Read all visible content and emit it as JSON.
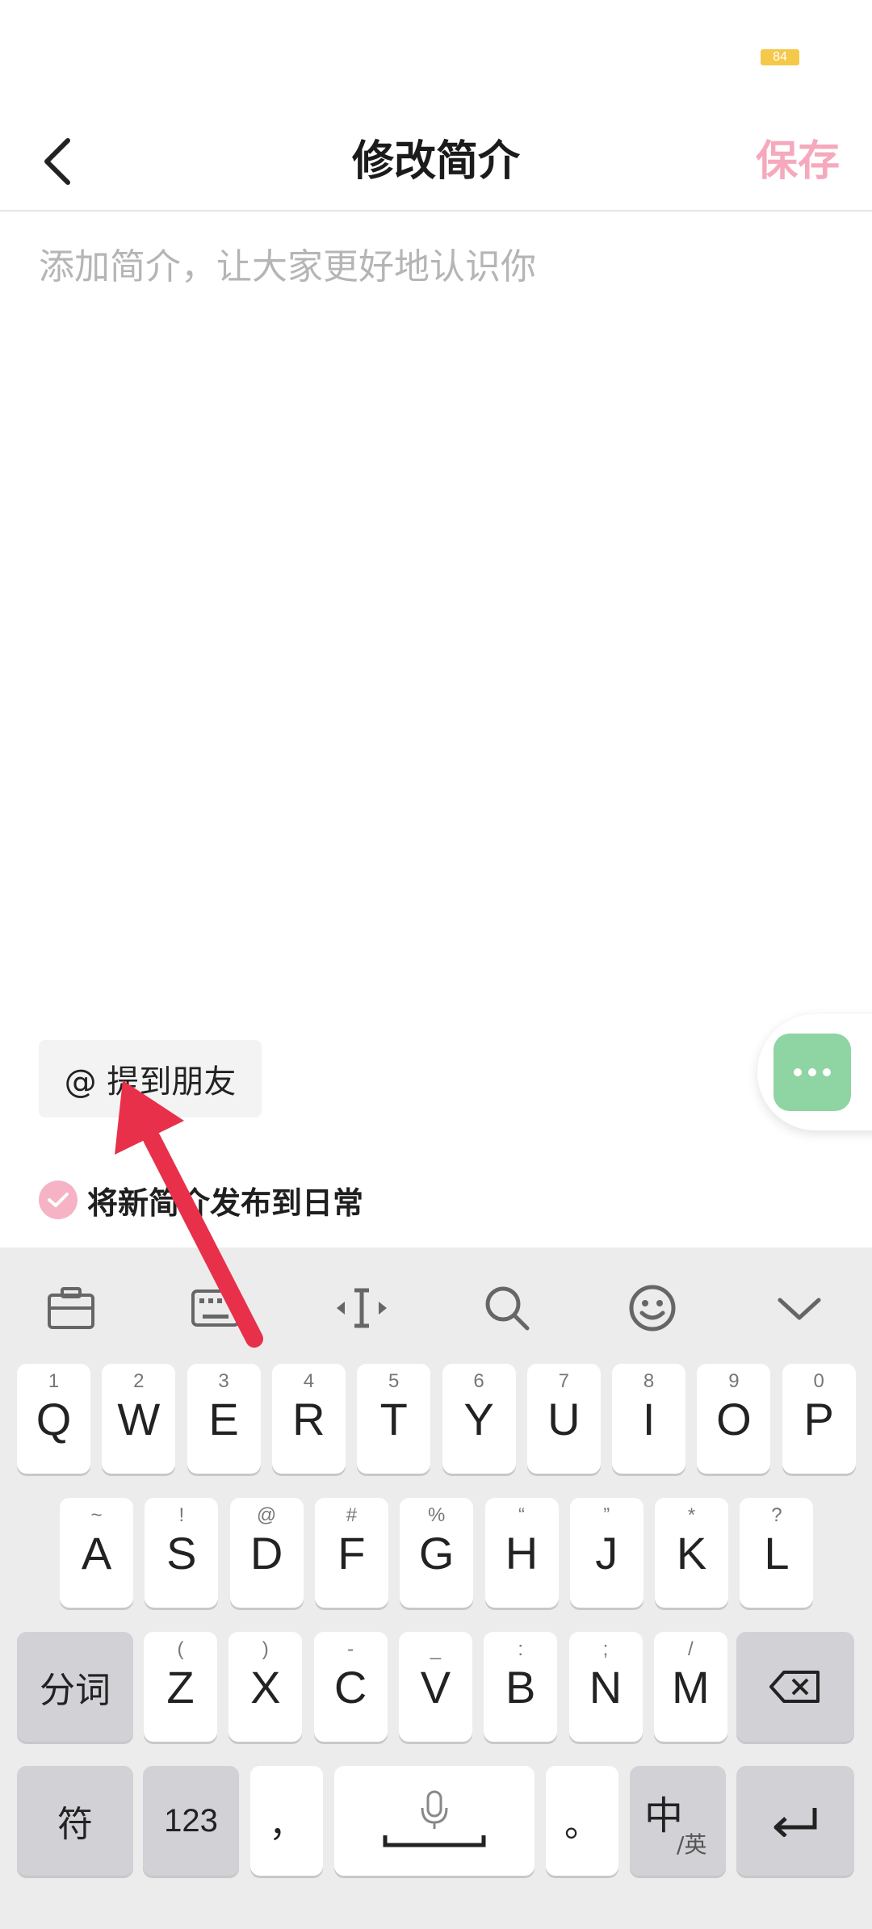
{
  "status": {
    "battery": "84"
  },
  "header": {
    "title": "修改简介",
    "save_label": "保存"
  },
  "bio": {
    "placeholder": "添加简介，让大家更好地认识你",
    "value": ""
  },
  "mention": {
    "label": "@ 提到朋友"
  },
  "publish": {
    "label": "将新简介发布到日常",
    "checked": true
  },
  "keyboard": {
    "row1": [
      {
        "main": "Q",
        "sub": "1"
      },
      {
        "main": "W",
        "sub": "2"
      },
      {
        "main": "E",
        "sub": "3"
      },
      {
        "main": "R",
        "sub": "4"
      },
      {
        "main": "T",
        "sub": "5"
      },
      {
        "main": "Y",
        "sub": "6"
      },
      {
        "main": "U",
        "sub": "7"
      },
      {
        "main": "I",
        "sub": "8"
      },
      {
        "main": "O",
        "sub": "9"
      },
      {
        "main": "P",
        "sub": "0"
      }
    ],
    "row2": [
      {
        "main": "A",
        "sub": "~"
      },
      {
        "main": "S",
        "sub": "!"
      },
      {
        "main": "D",
        "sub": "@"
      },
      {
        "main": "F",
        "sub": "#"
      },
      {
        "main": "G",
        "sub": "%"
      },
      {
        "main": "H",
        "sub": "“"
      },
      {
        "main": "J",
        "sub": "”"
      },
      {
        "main": "K",
        "sub": "*"
      },
      {
        "main": "L",
        "sub": "?"
      }
    ],
    "row3": [
      {
        "main": "Z",
        "sub": "("
      },
      {
        "main": "X",
        "sub": ")"
      },
      {
        "main": "C",
        "sub": "-"
      },
      {
        "main": "V",
        "sub": "_"
      },
      {
        "main": "B",
        "sub": ":"
      },
      {
        "main": "N",
        "sub": ";"
      },
      {
        "main": "M",
        "sub": "/"
      }
    ],
    "segment_label": "分词",
    "symbol_label": "符",
    "num_label": "123",
    "comma": "，",
    "period": "。",
    "lang_main": "中",
    "lang_sub": "/英"
  },
  "colors": {
    "accent_pink": "#f6a9bd",
    "float_green": "#8fd4a3",
    "arrow_red": "#e8304a"
  },
  "icons": [
    "back-icon",
    "more-dots-icon",
    "check-icon",
    "clipboard-icon",
    "keyboard-icon",
    "cursor-icon",
    "search-icon",
    "emoji-icon",
    "collapse-chevron-icon",
    "microphone-icon",
    "backspace-icon",
    "enter-icon"
  ]
}
